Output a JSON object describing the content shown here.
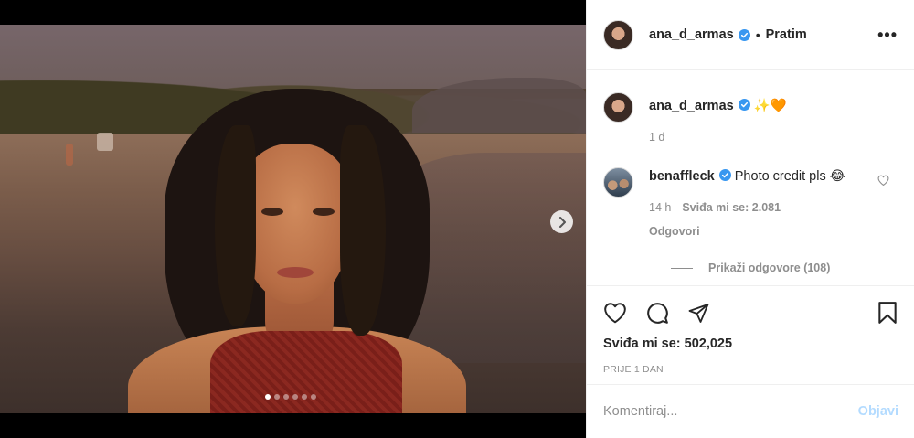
{
  "post": {
    "author": "ana_d_armas",
    "follow_label": "Pratim",
    "separator": "•",
    "more_label": "•••",
    "image_count": 6,
    "active_image": 0
  },
  "caption": {
    "username": "ana_d_armas",
    "text": "✨🧡",
    "age": "1 d"
  },
  "comment": {
    "username": "benaffleck",
    "text": "Photo credit pls 😂",
    "time": "14 h",
    "likes_label": "Sviđa mi se: 2.081",
    "reply_label": "Odgovori",
    "view_replies_label": "Prikaži odgovore (108)"
  },
  "actions": {
    "likes_label": "Sviđa mi se: 502,025",
    "date_label": "PRIJE 1 DAN"
  },
  "add_comment": {
    "placeholder": "Komentiraj...",
    "post_label": "Objavi"
  },
  "colors": {
    "verified": "#3897f0",
    "post_disabled": "#b3dbff",
    "secondary_text": "#8e8e8e"
  }
}
